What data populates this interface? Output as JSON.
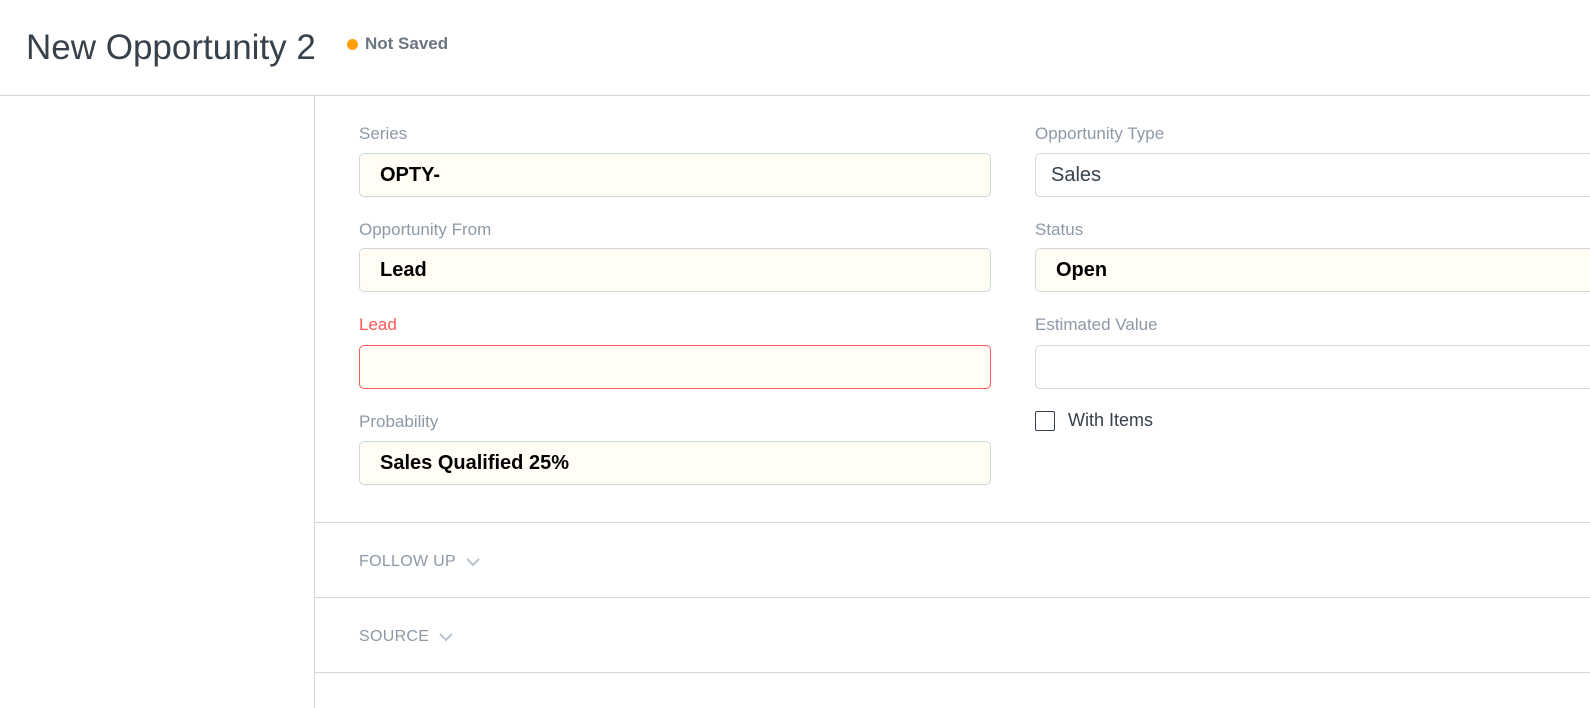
{
  "header": {
    "title": "New Opportunity 2",
    "indicator": {
      "text": "Not Saved",
      "color": "#ffa00a"
    }
  },
  "form": {
    "series": {
      "label": "Series",
      "value": "OPTY-"
    },
    "opportunity_from": {
      "label": "Opportunity From",
      "value": "Lead"
    },
    "lead": {
      "label": "Lead",
      "value": ""
    },
    "probability": {
      "label": "Probability",
      "value": "Sales Qualified 25%"
    },
    "opportunity_type": {
      "label": "Opportunity Type",
      "value": "Sales"
    },
    "status": {
      "label": "Status",
      "value": "Open"
    },
    "estimated_value": {
      "label": "Estimated Value",
      "value": ""
    },
    "with_items": {
      "label": "With Items",
      "checked": false
    }
  },
  "sections": [
    {
      "label": "FOLLOW UP",
      "icon": "chevron-down-icon"
    },
    {
      "label": "SOURCE",
      "icon": "chevron-down-icon"
    }
  ],
  "colors": {
    "required": "#ff5858",
    "input_bg": "#fffdf4",
    "border": "#d1d8dd"
  }
}
